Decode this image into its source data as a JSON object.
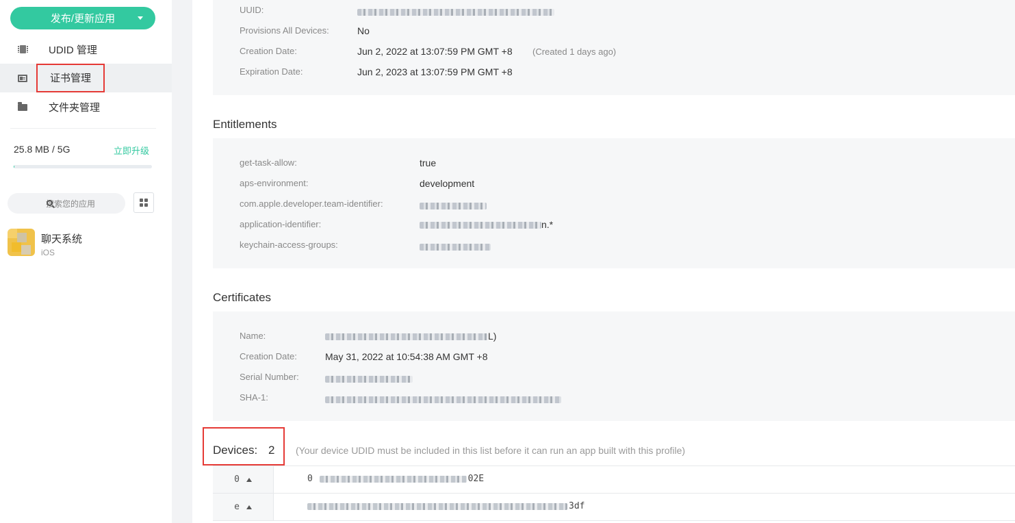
{
  "sidebar": {
    "publish_label": "发布/更新应用",
    "nav": [
      {
        "label": "UDID 管理",
        "icon": "chip-icon"
      },
      {
        "label": "证书管理",
        "icon": "id-card-icon",
        "active": true
      },
      {
        "label": "文件夹管理",
        "icon": "folder-icon"
      }
    ],
    "storage_text": "25.8 MB / 5G",
    "upgrade_label": "立即升级",
    "storage_used_fraction": 0.005,
    "search_placeholder": "搜索您的应用",
    "app": {
      "name": "聊天系统",
      "platform": "iOS"
    }
  },
  "profile": {
    "uuid_label": "UUID:",
    "provisions_label": "Provisions All Devices:",
    "provisions_value": "No",
    "creation_label": "Creation Date:",
    "creation_value": "Jun 2, 2022 at 13:07:59 PM GMT +8",
    "creation_extra": "(Created 1 days ago)",
    "expiration_label": "Expiration Date:",
    "expiration_value": "Jun 2, 2023 at 13:07:59 PM GMT +8"
  },
  "entitlements": {
    "title": "Entitlements",
    "rows": [
      {
        "key": "get-task-allow:",
        "value": "true"
      },
      {
        "key": "aps-environment:",
        "value": "development"
      },
      {
        "key": "com.apple.developer.team-identifier:",
        "value": ""
      },
      {
        "key": "application-identifier:",
        "value": "n.*"
      },
      {
        "key": "keychain-access-groups:",
        "value": ""
      }
    ]
  },
  "certificates": {
    "title": "Certificates",
    "name_label": "Name:",
    "name_tail": "L)",
    "creation_label": "Creation Date:",
    "creation_value": "May 31, 2022 at 10:54:38 AM GMT +8",
    "serial_label": "Serial Number:",
    "sha1_label": "SHA-1:"
  },
  "devices": {
    "title": "Devices:",
    "count": "2",
    "note": "(Your device UDID must be included in this list before it can run an app built with this profile)",
    "rows": [
      {
        "index": "0",
        "udid_head": "0",
        "udid_tail": "02E"
      },
      {
        "index": "e",
        "udid_head": "",
        "udid_tail": "3df"
      }
    ]
  }
}
